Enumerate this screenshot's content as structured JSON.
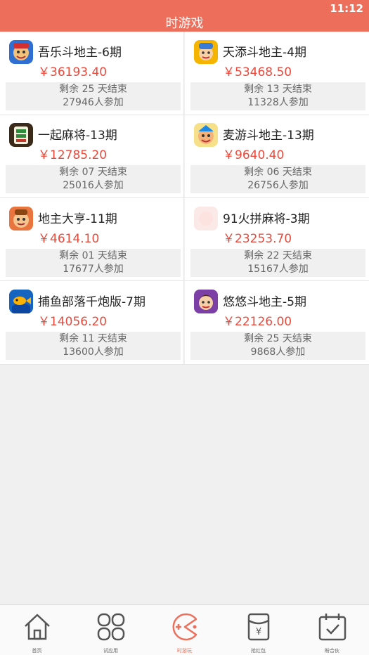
{
  "status_bar": {
    "time": "11:12"
  },
  "header": {
    "title": "时游戏"
  },
  "games": [
    {
      "name": "吾乐斗地主-6期",
      "prize": "￥36193.40",
      "remaining": "剩余 25 天结束",
      "participants": "27946人参加",
      "icon": "wule-doudizhu-icon"
    },
    {
      "name": "天添斗地主-4期",
      "prize": "￥53468.50",
      "remaining": "剩余 13 天结束",
      "participants": "11328人参加",
      "icon": "tiantian-doudizhu-icon"
    },
    {
      "name": "一起麻将-13期",
      "prize": "￥12785.20",
      "remaining": "剩余 07 天结束",
      "participants": "25016人参加",
      "icon": "yiqi-majiang-icon"
    },
    {
      "name": "麦游斗地主-13期",
      "prize": "￥9640.40",
      "remaining": "剩余 06 天结束",
      "participants": "26756人参加",
      "icon": "maiyou-doudizhu-icon"
    },
    {
      "name": "地主大亨-11期",
      "prize": "￥4614.10",
      "remaining": "剩余 01 天结束",
      "participants": "17677人参加",
      "icon": "dizhu-daheng-icon"
    },
    {
      "name": "91火拼麻将-3期",
      "prize": "￥23253.70",
      "remaining": "剩余 22 天结束",
      "participants": "15167人参加",
      "icon": "91-huopin-majiang-icon"
    },
    {
      "name": "捕鱼部落千炮版-7期",
      "prize": "￥14056.20",
      "remaining": "剩余 11 天结束",
      "participants": "13600人参加",
      "icon": "buyu-buluo-icon"
    },
    {
      "name": "悠悠斗地主-5期",
      "prize": "￥22126.00",
      "remaining": "剩余 25 天结束",
      "participants": "9868人参加",
      "icon": "youyou-doudizhu-icon"
    }
  ],
  "tabbar": {
    "tabs": [
      {
        "label": "首页",
        "icon": "home-icon",
        "active": false
      },
      {
        "label": "试应用",
        "icon": "apps-grid-icon",
        "active": false
      },
      {
        "label": "时游玩",
        "icon": "gamepad-icon",
        "active": true
      },
      {
        "label": "抢红包",
        "icon": "red-envelope-icon",
        "active": false
      },
      {
        "label": "盼合伙",
        "icon": "calendar-check-icon",
        "active": false
      }
    ]
  },
  "colors": {
    "accent": "#ed6e5b",
    "prize": "#e94a3c",
    "tab_inactive": "#666666"
  }
}
